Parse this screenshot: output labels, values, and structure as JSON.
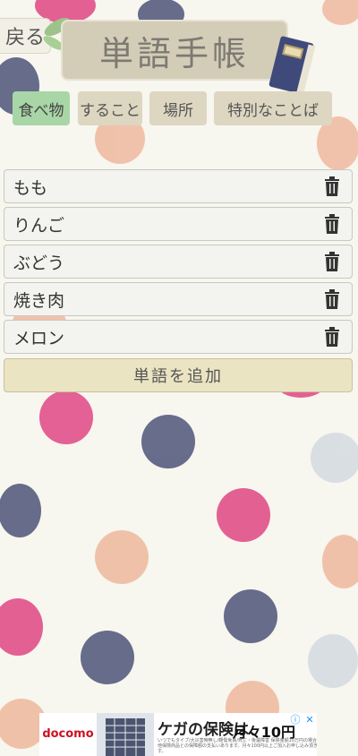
{
  "header": {
    "back_label": "戻る",
    "title": "単語手帳"
  },
  "tabs": [
    {
      "label": "食べ物",
      "active": true
    },
    {
      "label": "すること",
      "active": false
    },
    {
      "label": "場所",
      "active": false
    },
    {
      "label": "特別なことば",
      "active": false
    }
  ],
  "words": [
    {
      "text": "もも"
    },
    {
      "text": "りんご"
    },
    {
      "text": "ぶどう"
    },
    {
      "text": "焼き肉"
    },
    {
      "text": "メロン"
    }
  ],
  "add_button_label": "単語を追加",
  "ad": {
    "brand": "docomo",
    "headline": "ケガの保険は、",
    "price": "月々10円",
    "fine_print": "いつでもタイプ/大災害時無し/軽傷免責/死亡・後遺障害 保険金額10万円の場合 その他保険商品との保障額の支払いあります。月々100円以上ご加入お申し込み頂きます。"
  },
  "colors": {
    "tab_active": "#a9d6a6",
    "tab_inactive": "#ddd6c1",
    "add_button": "#ebe4c3",
    "dot_pink": "#e2588e",
    "dot_navy": "#5f6585",
    "dot_peach": "#f0bfa6",
    "dot_grey": "#d8dde3"
  }
}
